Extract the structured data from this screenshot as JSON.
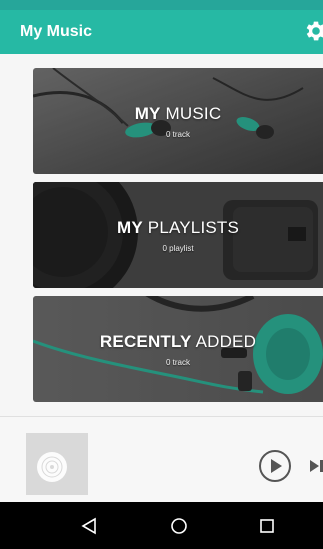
{
  "header": {
    "title": "My Music",
    "settings_icon": "gear-icon"
  },
  "cards": [
    {
      "bold": "MY",
      "light": " MUSIC",
      "sub": "0 track"
    },
    {
      "bold": "MY",
      "light": " PLAYLISTS",
      "sub": "0 playlist"
    },
    {
      "bold": "RECENTLY",
      "light": " ADDED",
      "sub": "0 track"
    }
  ],
  "player": {
    "art_icon": "vinyl-disc-icon",
    "play_icon": "play-icon",
    "next_icon": "skip-next-icon"
  },
  "navbar": {
    "back_icon": "back-triangle-icon",
    "home_icon": "home-circle-icon",
    "recents_icon": "recents-square-icon"
  },
  "colors": {
    "accent": "#26b9a4",
    "status_bar": "#26a69a",
    "headphone_green": "#2bb59a",
    "nav_bar": "#000000"
  }
}
